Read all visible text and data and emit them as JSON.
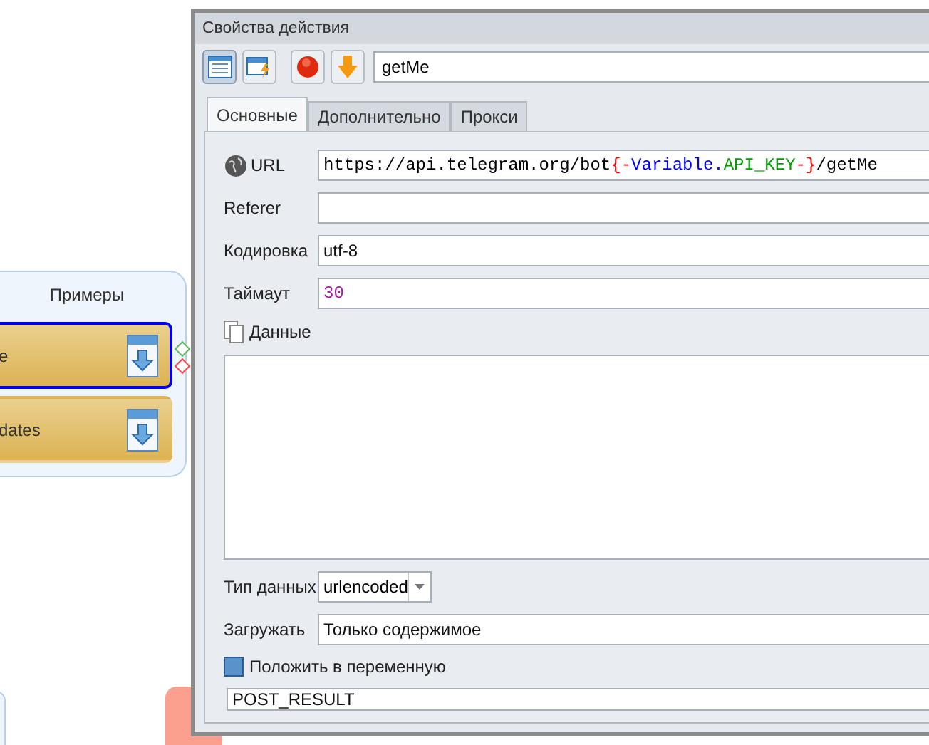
{
  "canvas": {
    "group": {
      "title": "Примеры",
      "items": [
        {
          "label": "e",
          "selected": true
        },
        {
          "label": "dates",
          "selected": false
        }
      ]
    }
  },
  "dialog": {
    "title": "Свойства действия",
    "toolbar": {
      "buttons": [
        {
          "kind": "table",
          "selected": true
        },
        {
          "kind": "window",
          "selected": false
        },
        {
          "kind": "stop",
          "selected": false
        },
        {
          "kind": "down",
          "selected": false
        }
      ],
      "name_value": "getMe"
    },
    "tabs": [
      {
        "label": "Основные",
        "selected": true
      },
      {
        "label": "Дополнительно",
        "selected": false
      },
      {
        "label": "Прокси",
        "selected": false
      }
    ],
    "url": {
      "label": "URL",
      "segments": [
        {
          "text": "https://api.telegram.org/bot",
          "color": "#000000"
        },
        {
          "text": "{-",
          "color": "#ff0000"
        },
        {
          "text": "Variable.",
          "color": "#0000ff"
        },
        {
          "text": "API_KEY",
          "color": "#00a000"
        },
        {
          "text": "-}",
          "color": "#ff0000"
        },
        {
          "text": "/getMe",
          "color": "#000000"
        }
      ]
    },
    "referer": {
      "label": "Referer"
    },
    "encoding": {
      "label": "Кодировка",
      "value": "utf-8"
    },
    "timeout": {
      "label": "Таймаут",
      "value": "30"
    },
    "data": {
      "label": "Данные"
    },
    "data_type": {
      "label": "Тип данных",
      "value": "urlencoded"
    },
    "load": {
      "label": "Загружать",
      "value": "Только содержимое"
    },
    "save": {
      "label": "Положить в переменную",
      "value": "POST_RESULT"
    }
  }
}
